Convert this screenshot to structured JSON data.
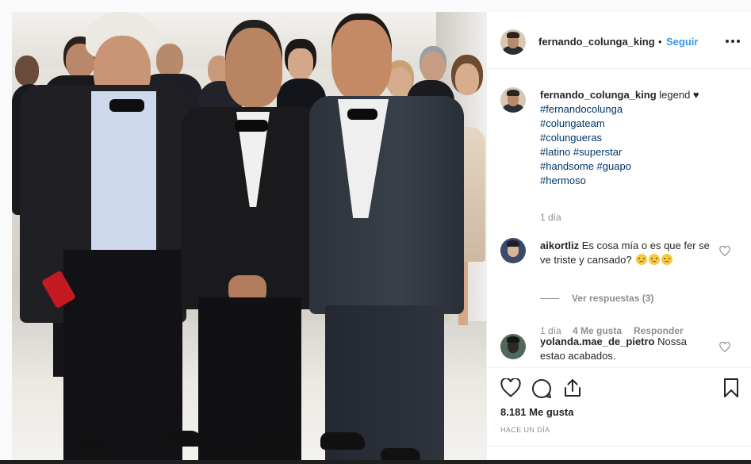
{
  "post": {
    "username": "fernando_colunga_king",
    "separator": "•",
    "follow_label": "Seguir",
    "caption_text": "legend ♥",
    "hashtags": [
      "#fernandocolunga",
      "#colungateam",
      "#colungueras",
      "#latino #superstar",
      "#handsome #guapo",
      "#hermoso"
    ],
    "caption_age": "1 día"
  },
  "comments": [
    {
      "username": "aikortliz",
      "text": "Es cosa mía o es que fer se ve triste y cansado?",
      "emojis": [
        "weary-face",
        "weary-face",
        "weary-face"
      ],
      "age": "1 día",
      "likes": "4 Me gusta",
      "reply_label": "Responder",
      "view_replies": "Ver respuestas (3)"
    },
    {
      "username": "yolanda.mae_de_pietro",
      "text": "Nossa estao acabados."
    }
  ],
  "actions": {
    "like_icon": "heart-outline-icon",
    "comment_icon": "comment-bubble-icon",
    "share_icon": "share-icon",
    "save_icon": "bookmark-icon",
    "likes_count": "8.181 Me gusta",
    "posted_ago": "HACE UN DÍA"
  },
  "colors": {
    "link": "#003569",
    "follow": "#3897f0",
    "muted": "#8e8e8e",
    "text": "#262626",
    "border": "#dbdbdb"
  }
}
